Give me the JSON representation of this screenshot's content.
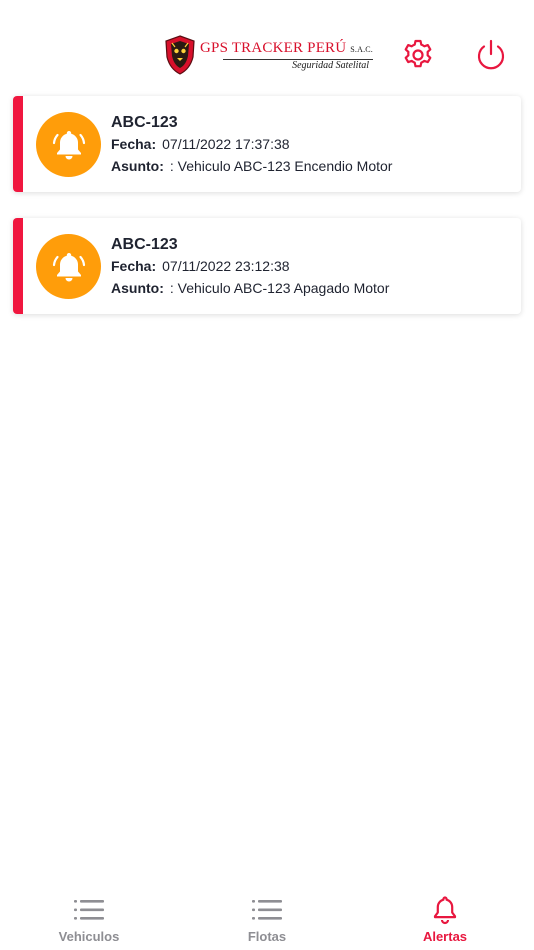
{
  "header": {
    "brand_main": "GPS TRACKER PERÚ",
    "brand_suffix": "S.A.C.",
    "tagline": "Seguridad Satelital",
    "settings_icon": "gear-icon",
    "power_icon": "power-icon"
  },
  "alerts": [
    {
      "plate": "ABC-123",
      "fecha_label": "Fecha:",
      "fecha": "07/11/2022 17:37:38",
      "asunto_label": "Asunto:",
      "asunto": ": Vehiculo ABC-123 Encendio Motor"
    },
    {
      "plate": "ABC-123",
      "fecha_label": "Fecha:",
      "fecha": "07/11/2022 23:12:38",
      "asunto_label": "Asunto:",
      "asunto": ": Vehiculo ABC-123 Apagado Motor"
    }
  ],
  "tabs": [
    {
      "label": "Vehiculos",
      "icon": "list-icon",
      "active": false
    },
    {
      "label": "Flotas",
      "icon": "list-icon",
      "active": false
    },
    {
      "label": "Alertas",
      "icon": "bell-icon",
      "active": true
    }
  ],
  "colors": {
    "accent": "#e8173f",
    "bell_circle": "#ff9d0a",
    "inactive": "#8e8e93"
  }
}
